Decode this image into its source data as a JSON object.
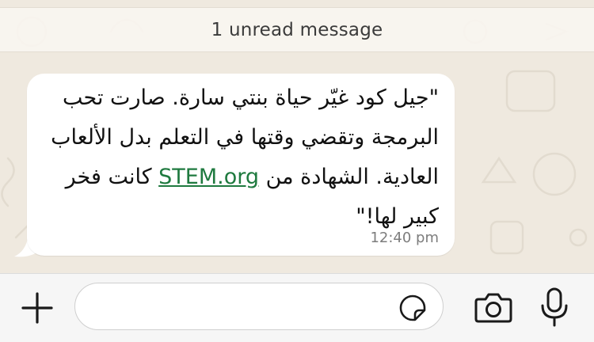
{
  "banner": {
    "unread_text": "1 unread message"
  },
  "message": {
    "text_before_link": "\"جيل كود غيّر حياة بنتي سارة. صارت تحب البرمجة وتقضي وقتها في التعلم بدل الألعاب العادية. الشهادة من ",
    "link_text": "STEM.org",
    "text_after_link": " كانت فخر كبير لها!\"",
    "time": "12:40 pm"
  },
  "composer": {
    "placeholder": "",
    "icons": [
      "plus-icon",
      "sticker-icon",
      "camera-icon",
      "microphone-icon"
    ]
  },
  "colors": {
    "wallpaper": "#efe9df",
    "bubble": "#ffffff",
    "link": "#1f7a3f",
    "icon": "#1a1a1a"
  }
}
